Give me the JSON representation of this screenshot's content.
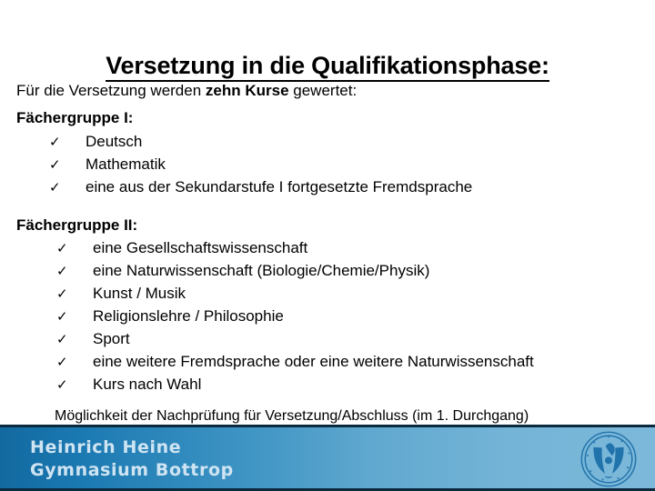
{
  "slide": {
    "title": "Versetzung in die Qualifikationsphase:",
    "lead_prefix": "Für die Versetzung werden ",
    "lead_bold": "zehn Kurse",
    "lead_suffix": " gewertet:",
    "groups": [
      {
        "heading": "Fächergruppe I:",
        "items": [
          "Deutsch",
          "Mathematik",
          "eine aus der Sekundarstufe I fortgesetzte Fremdsprache"
        ]
      },
      {
        "heading": "Fächergruppe II:",
        "items": [
          "eine Gesellschaftswissenschaft",
          "eine Naturwissenschaft (Biologie/Chemie/Physik)",
          "Kunst / Musik",
          "Religionslehre / Philosophie",
          "Sport",
          "eine weitere Fremdsprache oder eine weitere Naturwissenschaft",
          "Kurs nach Wahl"
        ]
      }
    ],
    "bullet_glyph": "✓",
    "closing_note": "Möglichkeit der Nachprüfung für Versetzung/Abschluss (im 1. Durchgang)"
  },
  "footer": {
    "school_line1": "Heinrich Heine",
    "school_line2": "Gymnasium Bottrop",
    "logo_label": "Heinrich Heine Gymnasium Bottrop",
    "colors": {
      "gradient_left": "#12699f",
      "gradient_right": "#7cb8d9",
      "border": "#0c2a3e",
      "text": "#cfe4f2",
      "logo": "#1a6ea8"
    }
  }
}
